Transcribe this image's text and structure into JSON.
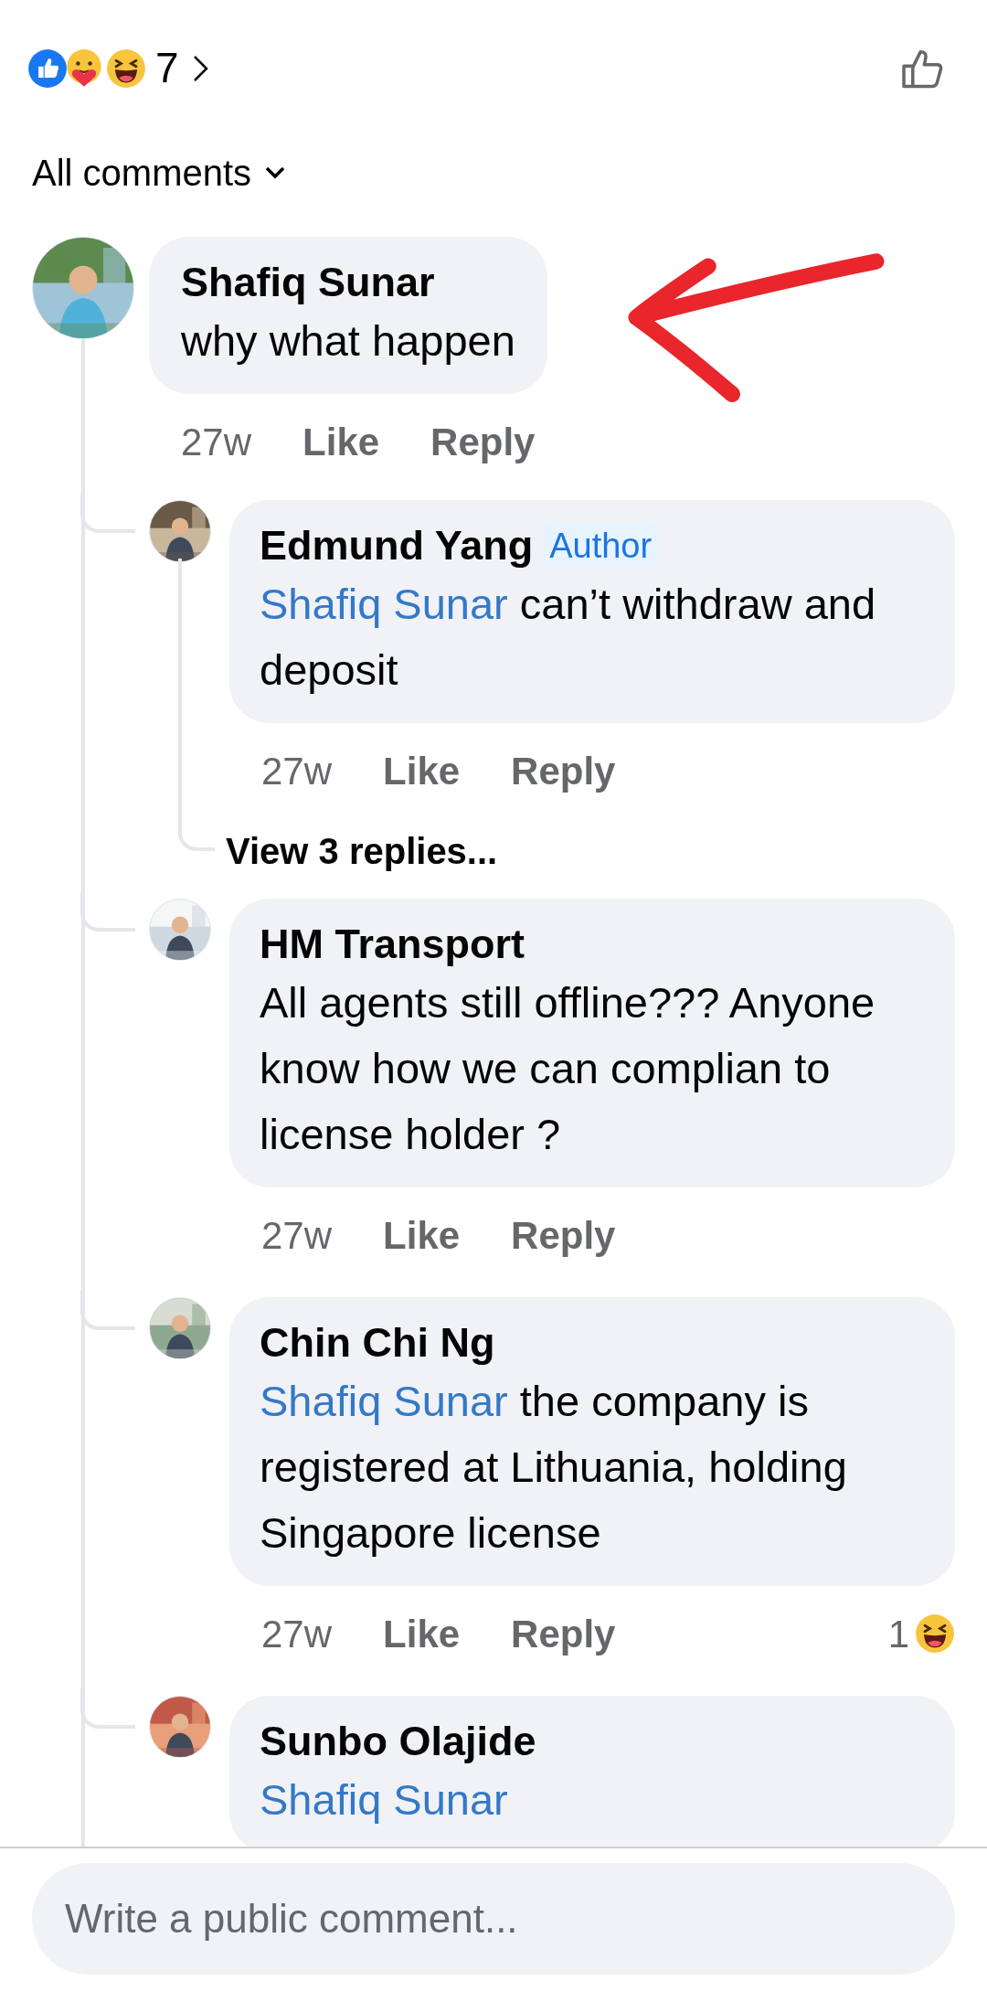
{
  "reactions": {
    "count": "7"
  },
  "filter": {
    "label": "All comments"
  },
  "comments": [
    {
      "author": "Shafiq Sunar",
      "text": "why what happen",
      "time": "27w",
      "actions": [
        "Like",
        "Reply"
      ],
      "replies": [
        {
          "author": "Edmund Yang",
          "badge": "Author",
          "mention": "Shafiq Sunar",
          "text": "can’t withdraw and deposit",
          "time": "27w",
          "actions": [
            "Like",
            "Reply"
          ],
          "more_replies": "View 3 replies..."
        },
        {
          "author": "HM Transport",
          "text": "All agents still offline??? Anyone know how we can complian to license holder ?",
          "time": "27w",
          "actions": [
            "Like",
            "Reply"
          ]
        },
        {
          "author": "Chin Chi Ng",
          "mention": "Shafiq Sunar",
          "text": "the company is registered at Lithuania, holding Singapore license",
          "time": "27w",
          "actions": [
            "Like",
            "Reply"
          ],
          "reaction_count": "1"
        },
        {
          "author": "Sunbo Olajide",
          "mention": "Shafiq Sunar"
        }
      ]
    }
  ],
  "composer": {
    "placeholder": "Write a public comment..."
  }
}
